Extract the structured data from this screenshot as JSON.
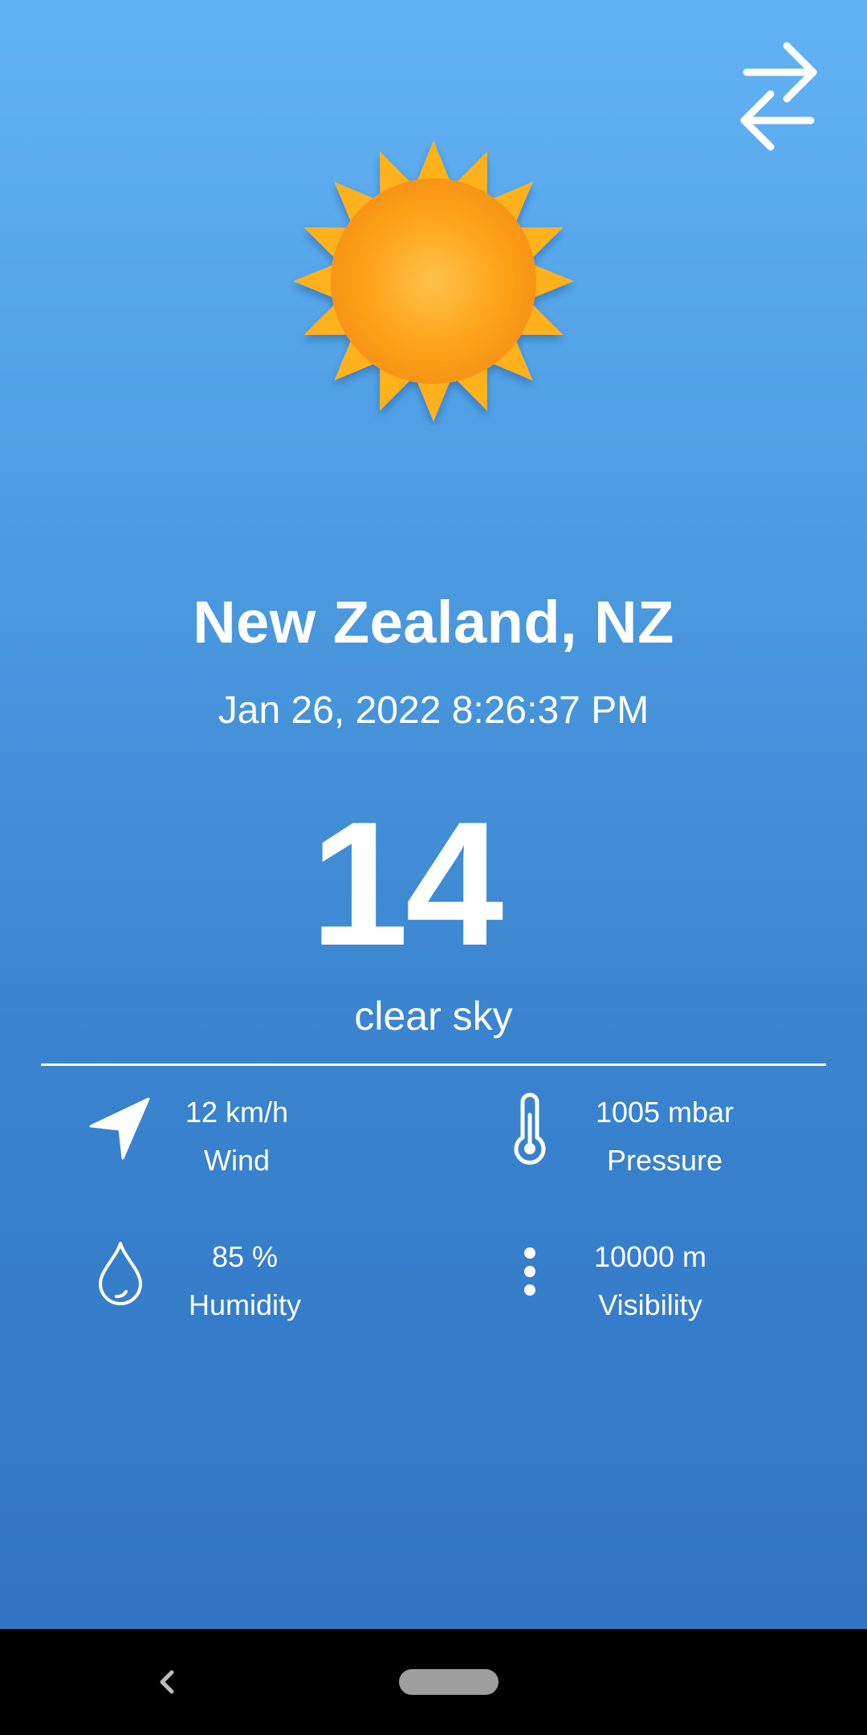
{
  "header": {
    "swap_icon": "swap-arrows-icon"
  },
  "weather": {
    "icon": "sun-icon",
    "location": "New Zealand, NZ",
    "datetime": "Jan 26, 2022 8:26:37 PM",
    "temperature": "14",
    "condition": "clear sky"
  },
  "stats": {
    "wind": {
      "icon": "navigation-arrow-icon",
      "value": "12 km/h",
      "label": "Wind"
    },
    "pressure": {
      "icon": "thermometer-icon",
      "value": "1005 mbar",
      "label": "Pressure"
    },
    "humidity": {
      "icon": "water-drop-icon",
      "value": "85 %",
      "label": "Humidity"
    },
    "visibility": {
      "icon": "more-vertical-icon",
      "value": "10000 m",
      "label": "Visibility"
    }
  },
  "navbar": {
    "back_icon": "back-chevron-icon",
    "home_icon": "home-pill-icon"
  },
  "colors": {
    "background_top": "#62b3f5",
    "background_bottom": "#2e73c2",
    "sun_body": "#ffa21a",
    "sun_rays": "#ffb21f",
    "text": "#ffffff",
    "navbar": "#000000"
  }
}
